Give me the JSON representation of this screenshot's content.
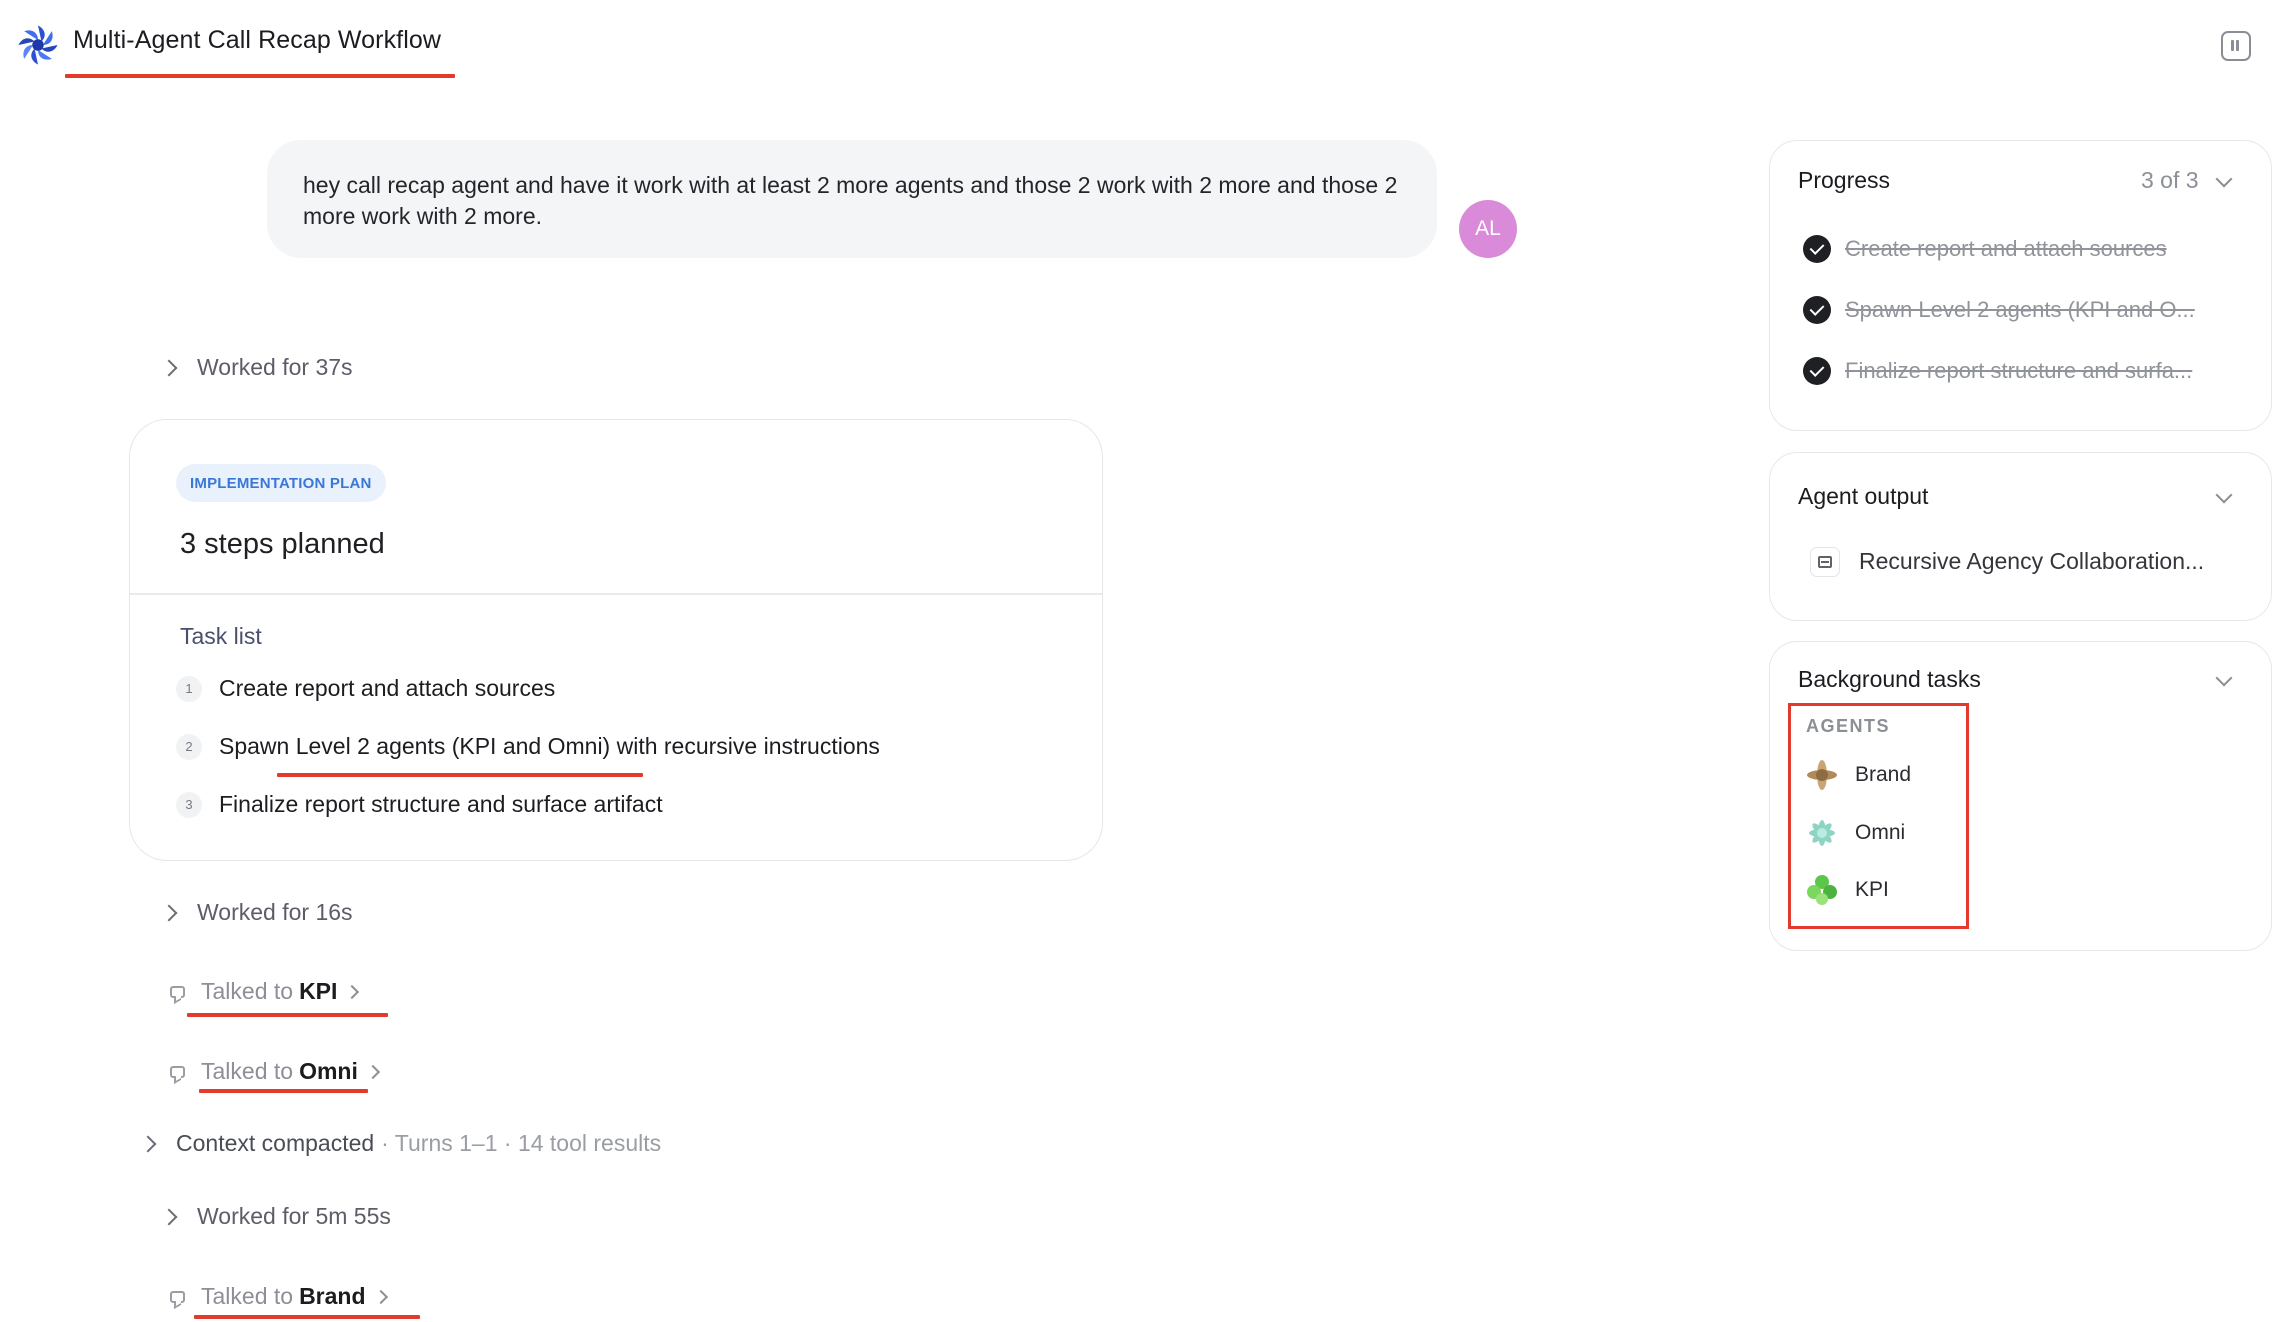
{
  "header": {
    "title": "Multi-Agent Call Recap Workflow",
    "logo_icon": "blue-flower-logo-icon",
    "sidebar_toggle_icon": "sidebar-toggle-icon"
  },
  "user_message": {
    "text": "hey call recap agent and have it work with at least 2 more agents and those 2 work with 2 more and those 2 more work with 2 more.",
    "avatar_initials": "AL",
    "avatar_color": "#d98ad8"
  },
  "worked_1": "Worked for 37s",
  "plan": {
    "badge": "IMPLEMENTATION PLAN",
    "heading": "3 steps planned",
    "task_list_label": "Task list",
    "tasks": [
      {
        "num": "1",
        "text": "Create report and attach sources"
      },
      {
        "num": "2",
        "text": "Spawn Level 2 agents (KPI and Omni) with recursive instructions"
      },
      {
        "num": "3",
        "text": "Finalize report structure and surface artifact"
      }
    ]
  },
  "worked_2": "Worked for 16s",
  "talk_kpi": {
    "prefix": "Talked to",
    "agent": "KPI"
  },
  "talk_omni": {
    "prefix": "Talked to",
    "agent": "Omni"
  },
  "context": {
    "label": "Context compacted",
    "meta": "· Turns 1–1 · 14 tool results"
  },
  "worked_3": "Worked for 5m 55s",
  "talk_brand": {
    "prefix": "Talked to",
    "agent": "Brand"
  },
  "progress": {
    "title": "Progress",
    "count": "3 of 3",
    "items": [
      "Create report and attach sources",
      "Spawn Level 2 agents (KPI and O...",
      "Finalize report structure and surfa..."
    ]
  },
  "agent_output": {
    "title": "Agent output",
    "item": "Recursive Agency Collaboration..."
  },
  "background_tasks": {
    "title": "Background tasks",
    "section_label": "AGENTS",
    "agents": [
      "Brand",
      "Omni",
      "KPI"
    ]
  },
  "colors": {
    "accent_red": "#e23b2e",
    "badge_blue": "#3a78d8"
  }
}
